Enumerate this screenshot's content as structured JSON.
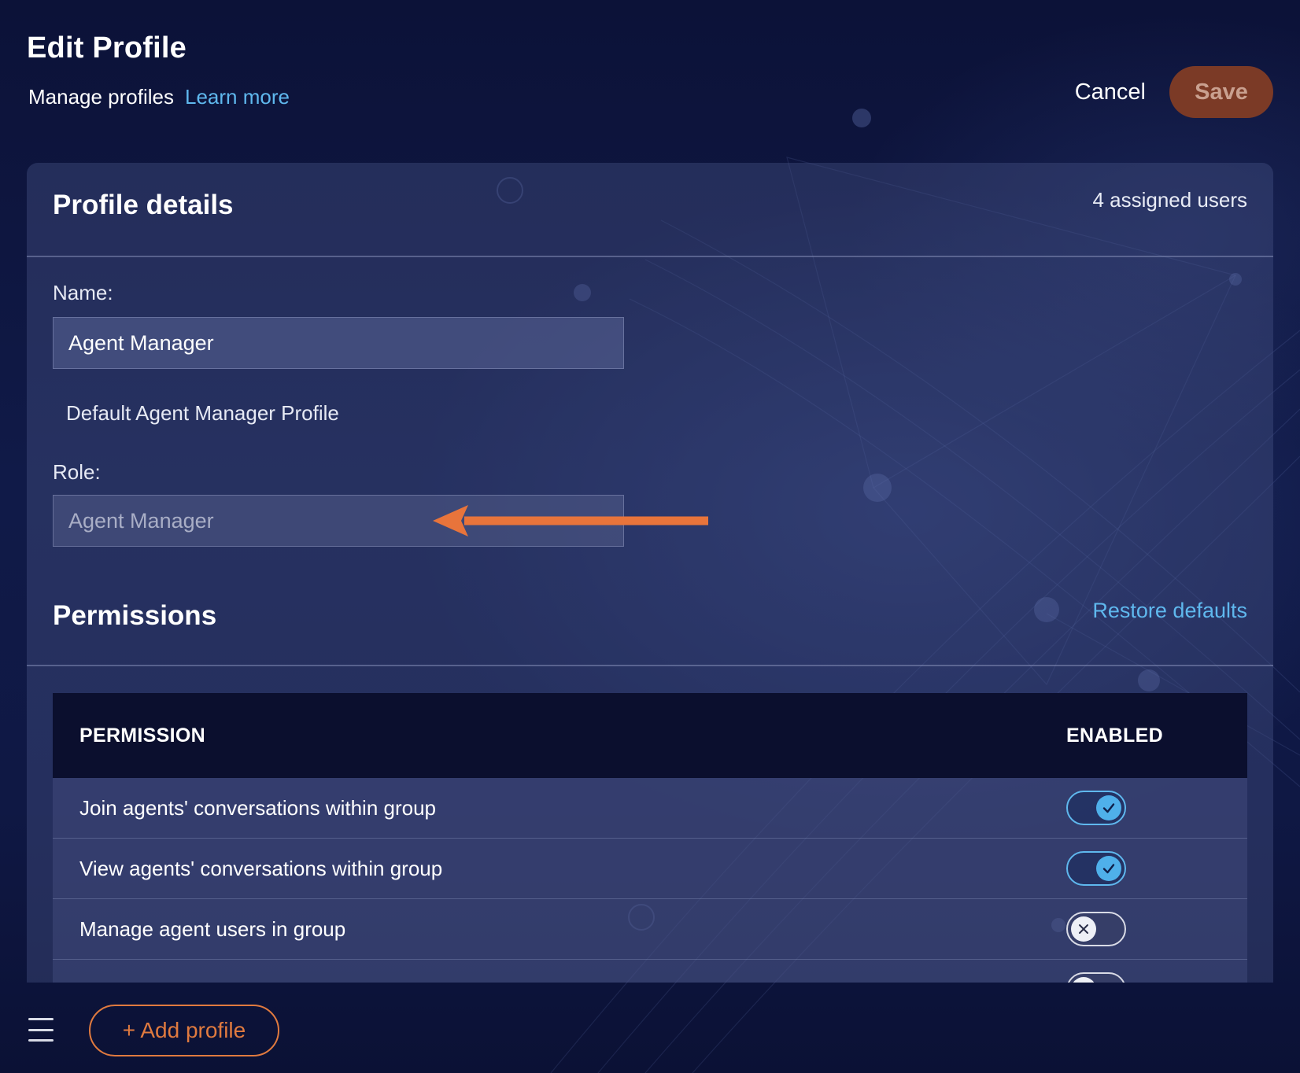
{
  "header": {
    "title": "Edit Profile",
    "subtitle": "Manage profiles",
    "learn_more": "Learn more",
    "cancel_label": "Cancel",
    "save_label": "Save"
  },
  "profile_details": {
    "heading": "Profile details",
    "assigned_users": "4 assigned users",
    "name_label": "Name:",
    "name_value": "Agent Manager",
    "description": "Default Agent Manager Profile",
    "role_label": "Role:",
    "role_value": "Agent Manager"
  },
  "permissions": {
    "heading": "Permissions",
    "restore_label": "Restore defaults",
    "columns": [
      "PERMISSION",
      "ENABLED"
    ],
    "rows": [
      {
        "label": "Join agents' conversations within group",
        "enabled": true
      },
      {
        "label": "View agents' conversations within group",
        "enabled": true
      },
      {
        "label": "Manage agent users in group",
        "enabled": false
      }
    ]
  },
  "footer": {
    "add_profile_label": "+ Add profile"
  },
  "colors": {
    "accent_link": "#5fb8ee",
    "save_bg": "#7b3a26",
    "add_border": "#e07a3f",
    "annotation_arrow": "#e8743b"
  },
  "icons": {
    "toggle_on": "check-icon",
    "toggle_off": "x-icon",
    "menu": "hamburger-icon"
  }
}
